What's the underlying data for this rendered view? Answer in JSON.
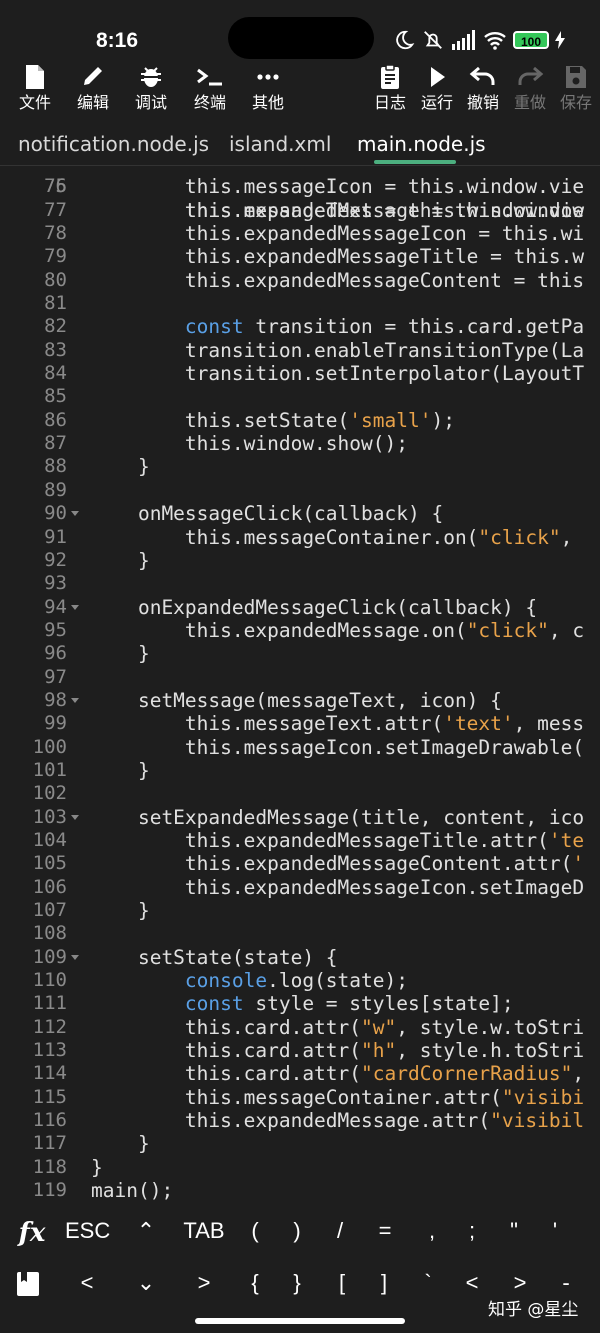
{
  "status": {
    "time": "8:16",
    "battery": "100",
    "icons": [
      "moon-icon",
      "mute-icon",
      "signal-icon",
      "wifi-icon",
      "battery-icon",
      "charging-icon"
    ]
  },
  "toolbar": {
    "file": "文件",
    "edit": "编辑",
    "debug": "调试",
    "terminal": "终端",
    "more": "其他",
    "log": "日志",
    "run": "运行",
    "undo": "撤销",
    "redo": "重做",
    "save": "保存"
  },
  "tabs": [
    "notification.node.js",
    "island.xml",
    "main.node.js"
  ],
  "active_tab": "main.node.js",
  "code": [
    {
      "n": "76",
      "fold": false,
      "html": "        this.messageIcon = this.window.vie"
    },
    {
      "n": "77",
      "fold": false,
      "html": "        this.expandedMessage = this.window"
    },
    {
      "n": "78",
      "fold": false,
      "html": "        this.expandedMessageIcon = this.wi"
    },
    {
      "n": "79",
      "fold": false,
      "html": "        this.expandedMessageTitle = this.w"
    },
    {
      "n": "80",
      "fold": false,
      "html": "        this.expandedMessageContent = this"
    },
    {
      "n": "81",
      "fold": false,
      "html": ""
    },
    {
      "n": "82",
      "fold": false,
      "html": "        <span class=\"kw\">const</span> transition = this.card.getPa"
    },
    {
      "n": "83",
      "fold": false,
      "html": "        transition.enableTransitionType(La"
    },
    {
      "n": "84",
      "fold": false,
      "html": "        transition.setInterpolator(LayoutT"
    },
    {
      "n": "85",
      "fold": false,
      "html": ""
    },
    {
      "n": "86",
      "fold": false,
      "html": "        this.setState(<span class=\"str\">'small'</span>);"
    },
    {
      "n": "87",
      "fold": false,
      "html": "        this.window.show();"
    },
    {
      "n": "88",
      "fold": false,
      "html": "    }"
    },
    {
      "n": "89",
      "fold": false,
      "html": ""
    },
    {
      "n": "90",
      "fold": true,
      "html": "    onMessageClick(callback) {"
    },
    {
      "n": "91",
      "fold": false,
      "html": "        this.messageContainer.on(<span class=\"str\">\"click\"</span>,"
    },
    {
      "n": "92",
      "fold": false,
      "html": "    }"
    },
    {
      "n": "93",
      "fold": false,
      "html": ""
    },
    {
      "n": "94",
      "fold": true,
      "html": "    onExpandedMessageClick(callback) {"
    },
    {
      "n": "95",
      "fold": false,
      "html": "        this.expandedMessage.on(<span class=\"str\">\"click\"</span>, c"
    },
    {
      "n": "96",
      "fold": false,
      "html": "    }"
    },
    {
      "n": "97",
      "fold": false,
      "html": ""
    },
    {
      "n": "98",
      "fold": true,
      "html": "    setMessage(messageText, icon) {"
    },
    {
      "n": "99",
      "fold": false,
      "html": "        this.messageText.attr(<span class=\"str\">'text'</span>, mess"
    },
    {
      "n": "100",
      "fold": false,
      "html": "        this.messageIcon.setImageDrawable("
    },
    {
      "n": "101",
      "fold": false,
      "html": "    }"
    },
    {
      "n": "102",
      "fold": false,
      "html": ""
    },
    {
      "n": "103",
      "fold": true,
      "html": "    setExpandedMessage(title, content, ico"
    },
    {
      "n": "104",
      "fold": false,
      "html": "        this.expandedMessageTitle.attr(<span class=\"str\">'te</span>"
    },
    {
      "n": "105",
      "fold": false,
      "html": "        this.expandedMessageContent.attr(<span class=\"str\">'</span>"
    },
    {
      "n": "106",
      "fold": false,
      "html": "        this.expandedMessageIcon.setImageD"
    },
    {
      "n": "107",
      "fold": false,
      "html": "    }"
    },
    {
      "n": "108",
      "fold": false,
      "html": ""
    },
    {
      "n": "109",
      "fold": true,
      "html": "    setState(state) {"
    },
    {
      "n": "110",
      "fold": false,
      "html": "        <span class=\"kw\">console</span>.log(state);"
    },
    {
      "n": "111",
      "fold": false,
      "html": "        <span class=\"kw\">const</span> style = styles[state];"
    },
    {
      "n": "112",
      "fold": false,
      "html": "        this.card.attr(<span class=\"str\">\"w\"</span>, style.w.toStri"
    },
    {
      "n": "113",
      "fold": false,
      "html": "        this.card.attr(<span class=\"str\">\"h\"</span>, style.h.toStri"
    },
    {
      "n": "114",
      "fold": false,
      "html": "        this.card.attr(<span class=\"str\">\"cardCornerRadius\"</span>,"
    },
    {
      "n": "115",
      "fold": false,
      "html": "        this.messageContainer.attr(<span class=\"str\">\"visibi</span>"
    },
    {
      "n": "116",
      "fold": false,
      "html": "        this.expandedMessage.attr(<span class=\"str\">\"visibil</span>"
    },
    {
      "n": "117",
      "fold": false,
      "html": "    }"
    },
    {
      "n": "118",
      "fold": false,
      "html": "}"
    },
    {
      "n": "119",
      "fold": false,
      "html": "main();"
    }
  ],
  "keys_row1": [
    "fx",
    "ESC",
    "⌃",
    "TAB",
    "(",
    ")",
    "/",
    "=",
    ",",
    ";",
    "\"",
    "'"
  ],
  "keys_row2": [
    "book-icon",
    "<",
    "⌄",
    ">",
    "{",
    "}",
    "[",
    "]",
    "`",
    "<",
    ">",
    "-"
  ],
  "watermark": "知乎 @星尘"
}
